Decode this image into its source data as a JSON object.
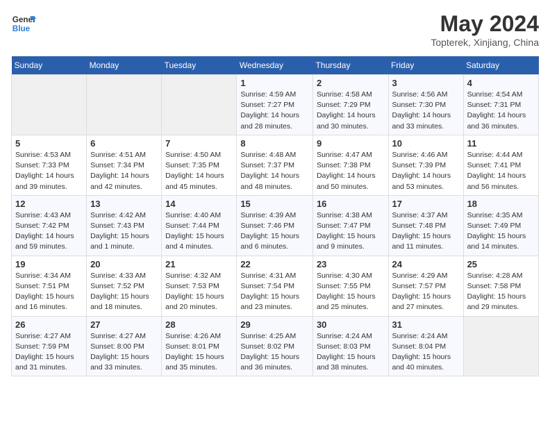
{
  "header": {
    "logo_line1": "General",
    "logo_line2": "Blue",
    "month_year": "May 2024",
    "location": "Topterek, Xinjiang, China"
  },
  "weekdays": [
    "Sunday",
    "Monday",
    "Tuesday",
    "Wednesday",
    "Thursday",
    "Friday",
    "Saturday"
  ],
  "weeks": [
    [
      {
        "day": "",
        "info": ""
      },
      {
        "day": "",
        "info": ""
      },
      {
        "day": "",
        "info": ""
      },
      {
        "day": "1",
        "info": "Sunrise: 4:59 AM\nSunset: 7:27 PM\nDaylight: 14 hours and 28 minutes."
      },
      {
        "day": "2",
        "info": "Sunrise: 4:58 AM\nSunset: 7:29 PM\nDaylight: 14 hours and 30 minutes."
      },
      {
        "day": "3",
        "info": "Sunrise: 4:56 AM\nSunset: 7:30 PM\nDaylight: 14 hours and 33 minutes."
      },
      {
        "day": "4",
        "info": "Sunrise: 4:54 AM\nSunset: 7:31 PM\nDaylight: 14 hours and 36 minutes."
      }
    ],
    [
      {
        "day": "5",
        "info": "Sunrise: 4:53 AM\nSunset: 7:33 PM\nDaylight: 14 hours and 39 minutes."
      },
      {
        "day": "6",
        "info": "Sunrise: 4:51 AM\nSunset: 7:34 PM\nDaylight: 14 hours and 42 minutes."
      },
      {
        "day": "7",
        "info": "Sunrise: 4:50 AM\nSunset: 7:35 PM\nDaylight: 14 hours and 45 minutes."
      },
      {
        "day": "8",
        "info": "Sunrise: 4:48 AM\nSunset: 7:37 PM\nDaylight: 14 hours and 48 minutes."
      },
      {
        "day": "9",
        "info": "Sunrise: 4:47 AM\nSunset: 7:38 PM\nDaylight: 14 hours and 50 minutes."
      },
      {
        "day": "10",
        "info": "Sunrise: 4:46 AM\nSunset: 7:39 PM\nDaylight: 14 hours and 53 minutes."
      },
      {
        "day": "11",
        "info": "Sunrise: 4:44 AM\nSunset: 7:41 PM\nDaylight: 14 hours and 56 minutes."
      }
    ],
    [
      {
        "day": "12",
        "info": "Sunrise: 4:43 AM\nSunset: 7:42 PM\nDaylight: 14 hours and 59 minutes."
      },
      {
        "day": "13",
        "info": "Sunrise: 4:42 AM\nSunset: 7:43 PM\nDaylight: 15 hours and 1 minute."
      },
      {
        "day": "14",
        "info": "Sunrise: 4:40 AM\nSunset: 7:44 PM\nDaylight: 15 hours and 4 minutes."
      },
      {
        "day": "15",
        "info": "Sunrise: 4:39 AM\nSunset: 7:46 PM\nDaylight: 15 hours and 6 minutes."
      },
      {
        "day": "16",
        "info": "Sunrise: 4:38 AM\nSunset: 7:47 PM\nDaylight: 15 hours and 9 minutes."
      },
      {
        "day": "17",
        "info": "Sunrise: 4:37 AM\nSunset: 7:48 PM\nDaylight: 15 hours and 11 minutes."
      },
      {
        "day": "18",
        "info": "Sunrise: 4:35 AM\nSunset: 7:49 PM\nDaylight: 15 hours and 14 minutes."
      }
    ],
    [
      {
        "day": "19",
        "info": "Sunrise: 4:34 AM\nSunset: 7:51 PM\nDaylight: 15 hours and 16 minutes."
      },
      {
        "day": "20",
        "info": "Sunrise: 4:33 AM\nSunset: 7:52 PM\nDaylight: 15 hours and 18 minutes."
      },
      {
        "day": "21",
        "info": "Sunrise: 4:32 AM\nSunset: 7:53 PM\nDaylight: 15 hours and 20 minutes."
      },
      {
        "day": "22",
        "info": "Sunrise: 4:31 AM\nSunset: 7:54 PM\nDaylight: 15 hours and 23 minutes."
      },
      {
        "day": "23",
        "info": "Sunrise: 4:30 AM\nSunset: 7:55 PM\nDaylight: 15 hours and 25 minutes."
      },
      {
        "day": "24",
        "info": "Sunrise: 4:29 AM\nSunset: 7:57 PM\nDaylight: 15 hours and 27 minutes."
      },
      {
        "day": "25",
        "info": "Sunrise: 4:28 AM\nSunset: 7:58 PM\nDaylight: 15 hours and 29 minutes."
      }
    ],
    [
      {
        "day": "26",
        "info": "Sunrise: 4:27 AM\nSunset: 7:59 PM\nDaylight: 15 hours and 31 minutes."
      },
      {
        "day": "27",
        "info": "Sunrise: 4:27 AM\nSunset: 8:00 PM\nDaylight: 15 hours and 33 minutes."
      },
      {
        "day": "28",
        "info": "Sunrise: 4:26 AM\nSunset: 8:01 PM\nDaylight: 15 hours and 35 minutes."
      },
      {
        "day": "29",
        "info": "Sunrise: 4:25 AM\nSunset: 8:02 PM\nDaylight: 15 hours and 36 minutes."
      },
      {
        "day": "30",
        "info": "Sunrise: 4:24 AM\nSunset: 8:03 PM\nDaylight: 15 hours and 38 minutes."
      },
      {
        "day": "31",
        "info": "Sunrise: 4:24 AM\nSunset: 8:04 PM\nDaylight: 15 hours and 40 minutes."
      },
      {
        "day": "",
        "info": ""
      }
    ]
  ]
}
